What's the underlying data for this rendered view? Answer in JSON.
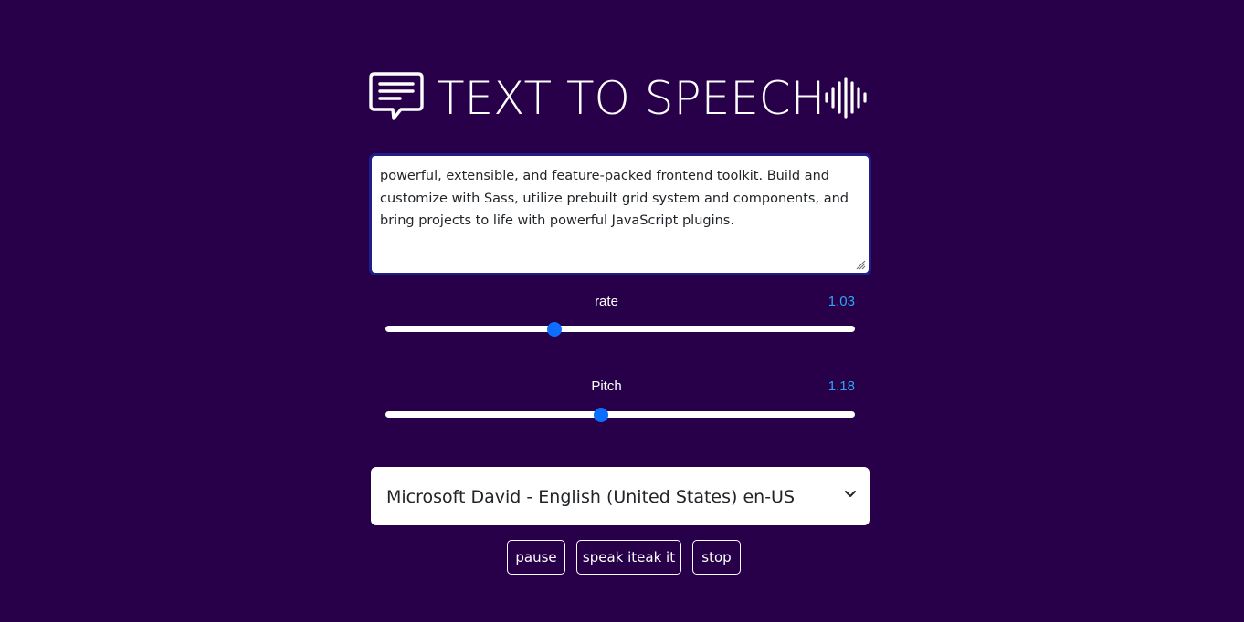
{
  "header": {
    "title": "TEXT TO SPEECH",
    "icons": [
      "chat-bubble-icon",
      "sound-wave-icon"
    ]
  },
  "text_input": {
    "value": "powerful, extensible, and feature-packed frontend toolkit. Build and customize with Sass, utilize prebuilt grid system and components, and bring projects to life with powerful JavaScript plugins."
  },
  "rate": {
    "label": "rate",
    "value": "1.03",
    "level_fraction": 0.36
  },
  "pitch": {
    "label": "Pitch",
    "value": "1.18",
    "level_fraction": 0.46
  },
  "voice": {
    "selected": "Microsoft David - English (United States) en-US"
  },
  "buttons": {
    "pause": "pause",
    "speak": "speak iteak it",
    "stop": "stop"
  },
  "colors": {
    "background": "#28004a",
    "accent": "#0d6efd",
    "value_text": "#2fa4f5",
    "textarea_border": "#1f1e8a"
  }
}
